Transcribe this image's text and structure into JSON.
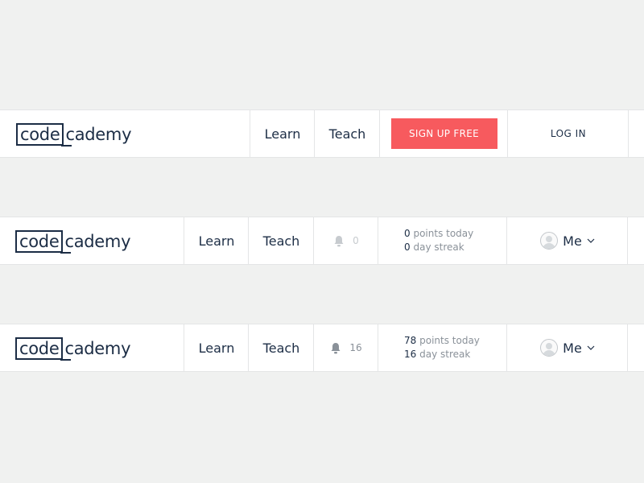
{
  "logo": {
    "code": "code",
    "cademy": "cademy"
  },
  "nav": {
    "learn": "Learn",
    "teach": "Teach"
  },
  "guest": {
    "signup_label": "SIGN UP FREE",
    "login_label": "LOG IN"
  },
  "user_new": {
    "notifications": "0",
    "points_value": "0",
    "points_label": "points today",
    "streak_value": "0",
    "streak_label": "day streak",
    "menu_label": "Me"
  },
  "user_active": {
    "notifications": "16",
    "points_value": "78",
    "points_label": "points today",
    "streak_value": "16",
    "streak_label": "day streak",
    "menu_label": "Me"
  },
  "colors": {
    "background": "#f0f1f0",
    "brand_navy": "#1c2d45",
    "signup_red": "#f75a5e",
    "muted_text": "#8a9199"
  },
  "icons": [
    "bell-icon",
    "avatar-icon",
    "chevron-down-icon"
  ]
}
